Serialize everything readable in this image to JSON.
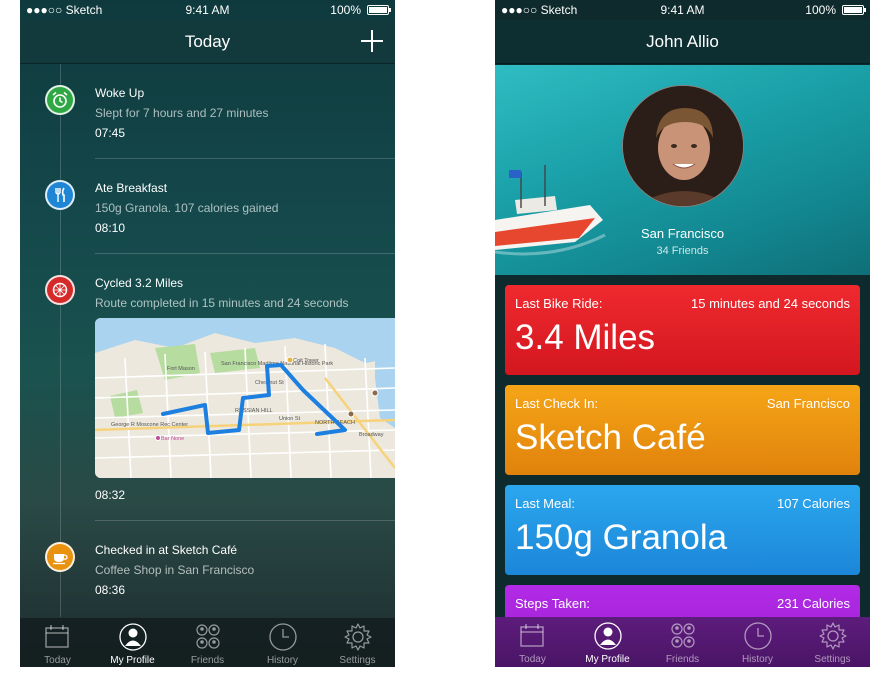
{
  "status_bar": {
    "carrier": "●●●○○ Sketch",
    "time": "9:41 AM",
    "battery": "100%"
  },
  "colors": {
    "bike_card": "#e01e27",
    "checkin_card": "#eb9410",
    "meal_card": "#2196e0",
    "steps_card": "#a020d8",
    "woke_icon": "#2fa844",
    "breakfast_icon": "#1f86d6",
    "cycle_icon": "#d52a2a",
    "coffee_icon": "#e8920f",
    "route": "#1d7fe0"
  },
  "today_screen": {
    "title": "Today",
    "add_icon": "plus-icon",
    "entries": [
      {
        "icon": "alarm-clock-icon",
        "title": "Woke Up",
        "subtitle": "Slept for 7 hours and 27 minutes",
        "time": "07:45"
      },
      {
        "icon": "fork-knife-icon",
        "title": "Ate Breakfast",
        "subtitle": "150g Granola. 107 calories gained",
        "time": "08:10"
      },
      {
        "icon": "bike-wheel-icon",
        "title": "Cycled 3.2 Miles",
        "subtitle": "Route completed in 15 minutes and 24 seconds",
        "time": "08:32"
      },
      {
        "icon": "coffee-cup-icon",
        "title": "Checked in at Sketch Café",
        "subtitle": "Coffee Shop in San Francisco",
        "time": "08:36"
      }
    ],
    "map_labels": {
      "fort_mason": "Fort Mason",
      "sf_maritime": "San Francisco Maritime National Historic Park",
      "coit_tower": "Coit Tower",
      "georgia_moscone": "George R Moscone Rec Center",
      "russian_hill": "RUSSIAN HILL",
      "north_beach": "NORTH BEACH",
      "bar_none": "Bar None",
      "chestnut": "Chestnut St",
      "union": "Union St",
      "broadway": "Broadway"
    }
  },
  "profile_screen": {
    "title": "John Allio",
    "city": "San Francisco",
    "friends": "34 Friends",
    "cards": [
      {
        "label": "Last Bike Ride:",
        "detail": "15 minutes and 24 seconds",
        "value": "3.4 Miles"
      },
      {
        "label": "Last Check In:",
        "detail": "San Francisco",
        "value": "Sketch Café"
      },
      {
        "label": "Last Meal:",
        "detail": "107 Calories",
        "value": "150g Granola"
      },
      {
        "label": "Steps Taken:",
        "detail": "231 Calories",
        "value": ""
      }
    ]
  },
  "tab_bar": {
    "tabs": [
      {
        "label": "Today",
        "icon": "calendar-icon"
      },
      {
        "label": "My Profile",
        "icon": "profile-icon"
      },
      {
        "label": "Friends",
        "icon": "friends-icon"
      },
      {
        "label": "History",
        "icon": "clock-icon"
      },
      {
        "label": "Settings",
        "icon": "gear-icon"
      }
    ],
    "active_index": 1
  }
}
